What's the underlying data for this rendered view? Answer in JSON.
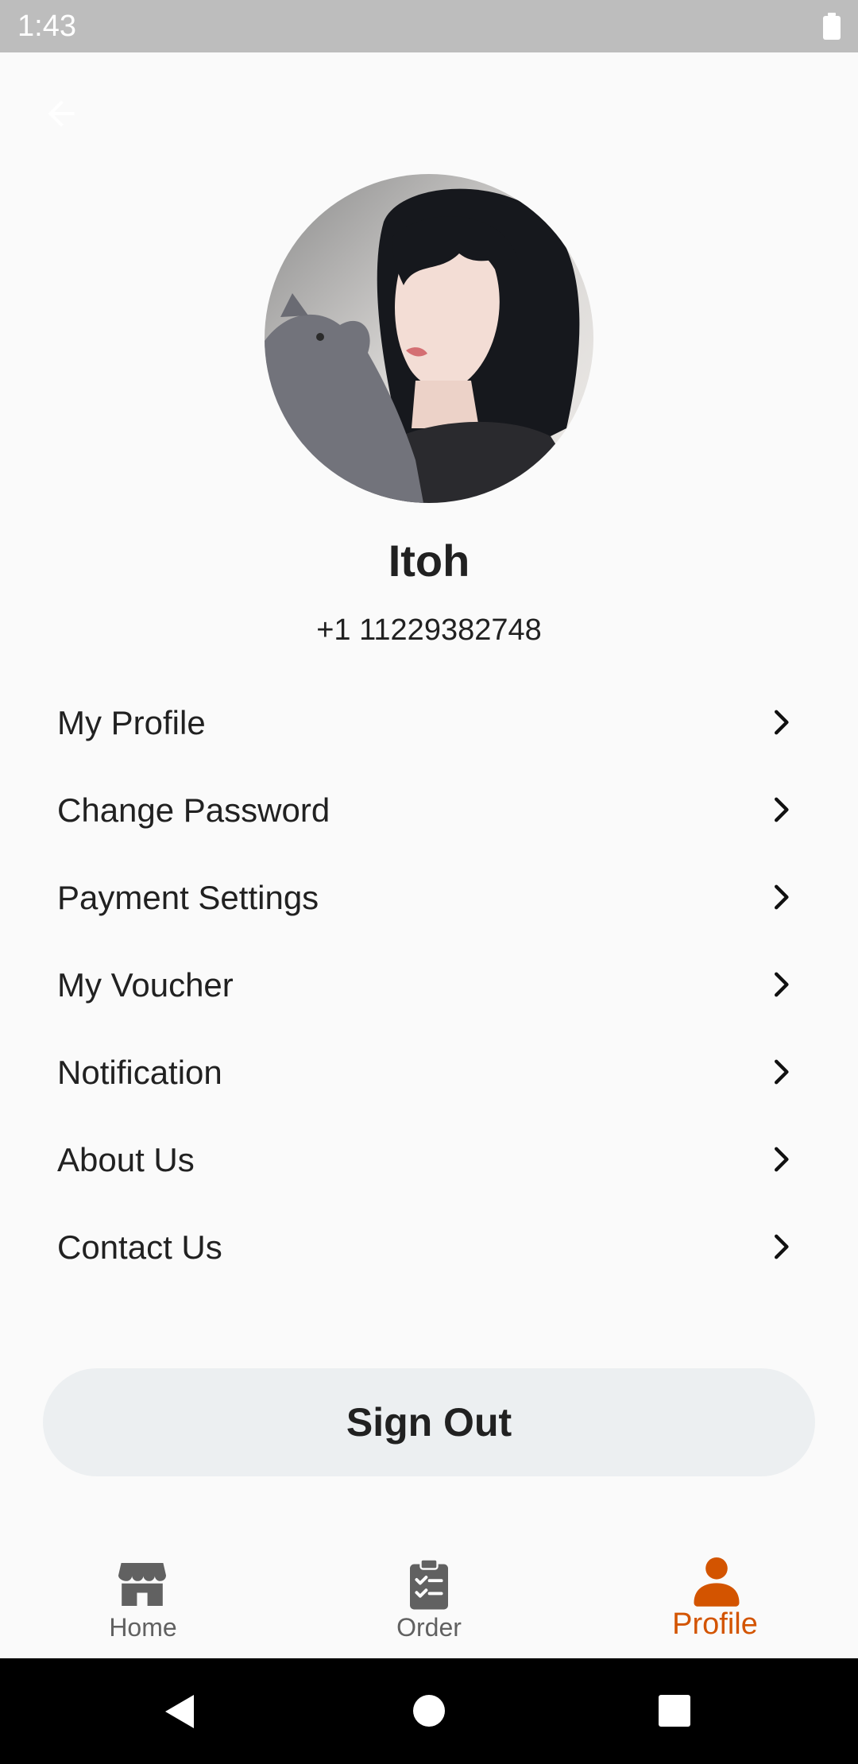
{
  "status_bar": {
    "time": "1:43",
    "icons": [
      "battery-icon"
    ]
  },
  "header": {
    "back_icon": "arrow-left-icon"
  },
  "profile": {
    "name": "Itoh",
    "phone": "+1 11229382748"
  },
  "menu": {
    "items": [
      {
        "label": "My Profile"
      },
      {
        "label": "Change Password"
      },
      {
        "label": "Payment Settings"
      },
      {
        "label": "My Voucher"
      },
      {
        "label": "Notification"
      },
      {
        "label": "About Us"
      },
      {
        "label": "Contact Us"
      }
    ],
    "chevron_icon": "chevron-right-icon"
  },
  "actions": {
    "sign_out_label": "Sign Out"
  },
  "bottom_nav": {
    "tabs": [
      {
        "label": "Home",
        "icon": "store-icon",
        "active": false
      },
      {
        "label": "Order",
        "icon": "clipboard-check-icon",
        "active": false
      },
      {
        "label": "Profile",
        "icon": "person-icon",
        "active": true
      }
    ]
  },
  "system_nav": {
    "buttons": [
      "back-triangle-icon",
      "home-circle-icon",
      "recents-square-icon"
    ]
  },
  "colors": {
    "accent": "#d35400",
    "inactive": "#616161",
    "background": "#fafafa",
    "status_bar": "#bdbdbd",
    "button_bg": "#eceff1"
  }
}
